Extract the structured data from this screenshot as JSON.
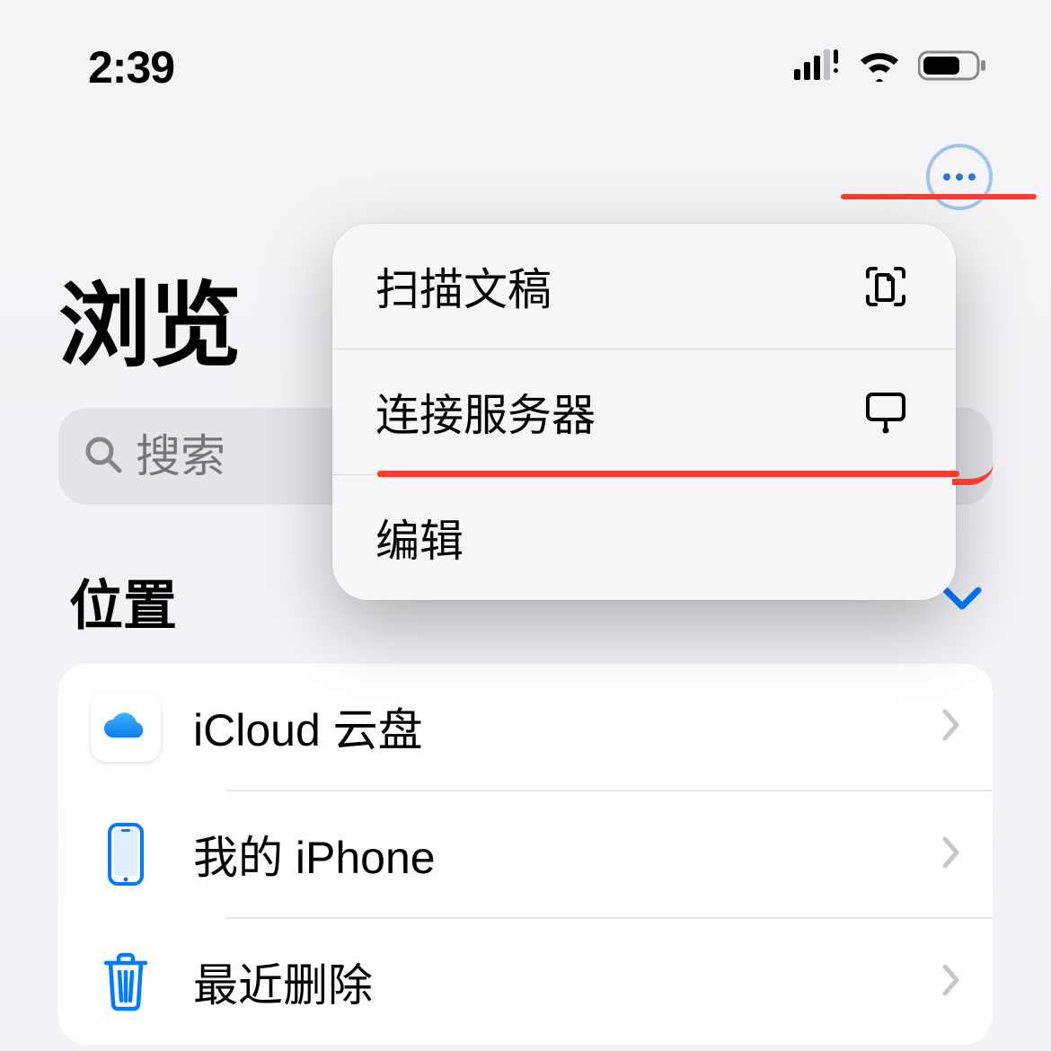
{
  "status": {
    "time": "2:39"
  },
  "page": {
    "title": "浏览"
  },
  "search": {
    "placeholder": "搜索"
  },
  "menu": {
    "items": [
      {
        "label": "扫描文稿",
        "icon": "doc-scan-icon"
      },
      {
        "label": "连接服务器",
        "icon": "server-connect-icon"
      },
      {
        "label": "编辑",
        "icon": ""
      }
    ]
  },
  "locations": {
    "header": "位置",
    "items": [
      {
        "label": "iCloud 云盘",
        "icon": "icloud-icon"
      },
      {
        "label": "我的 iPhone",
        "icon": "iphone-icon"
      },
      {
        "label": "最近删除",
        "icon": "trash-icon"
      }
    ]
  }
}
